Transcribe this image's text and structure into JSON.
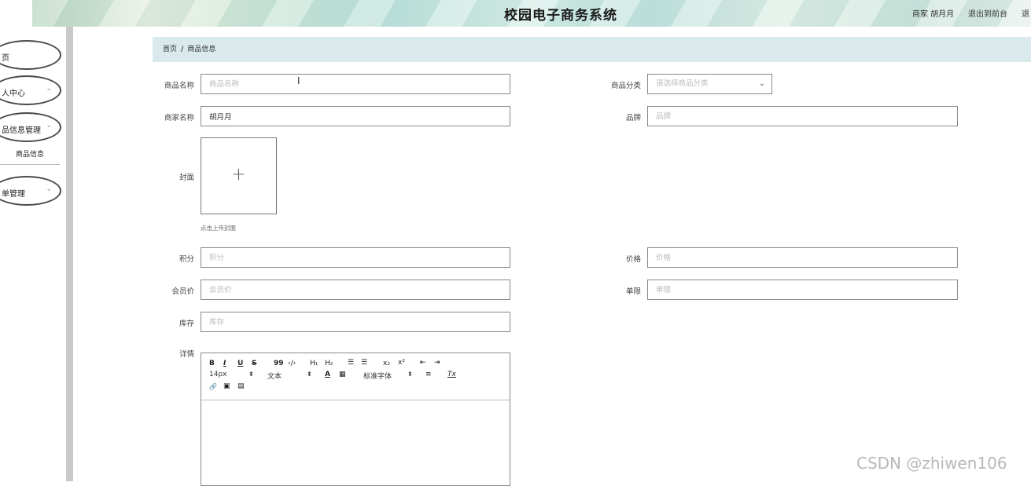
{
  "header": {
    "title": "校园电子商务系统",
    "user_label": "商家 胡月月",
    "front_link": "退出到前台",
    "logout_link": "退"
  },
  "sidebar": {
    "items": [
      {
        "label": "页",
        "has_chevron": false
      },
      {
        "label": "人中心",
        "has_chevron": true
      },
      {
        "label": "品信息管理",
        "has_chevron": true
      },
      {
        "label": "单管理",
        "has_chevron": true
      }
    ],
    "sub_item": "商品信息",
    "chevron": "⌄"
  },
  "breadcrumb": {
    "home": "首页",
    "separator": "/",
    "current": "商品信息"
  },
  "form": {
    "product_name": {
      "label": "商品名称",
      "value": "",
      "placeholder": "商品名称"
    },
    "category": {
      "label": "商品分类",
      "value": "",
      "placeholder": "请选择商品分类"
    },
    "merchant_name": {
      "label": "商家名称",
      "value": "胡月月",
      "placeholder": ""
    },
    "brand": {
      "label": "品牌",
      "value": "",
      "placeholder": "品牌"
    },
    "cover": {
      "label": "封面",
      "plus": "+",
      "hint": "点击上传封面"
    },
    "points": {
      "label": "积分",
      "value": "",
      "placeholder": "积分"
    },
    "price": {
      "label": "价格",
      "value": "",
      "placeholder": "价格"
    },
    "member_price": {
      "label": "会员价",
      "value": "",
      "placeholder": "会员价"
    },
    "limit": {
      "label": "单限",
      "value": "",
      "placeholder": "单限"
    },
    "stock": {
      "label": "库存",
      "value": "",
      "placeholder": "库存"
    },
    "details": {
      "label": "详情"
    }
  },
  "editor": {
    "font_size": "14px",
    "text_style": "文本",
    "font_family": "标准字体",
    "buttons": {
      "bold": "B",
      "italic": "I",
      "underline": "U",
      "strike": "S",
      "quote": "99",
      "code": "‹/›",
      "h1": "H₁",
      "h2": "H₂",
      "ordered_list": "☰",
      "bullet_list": "☰",
      "subscript": "x₂",
      "superscript": "x²",
      "indent_dec": "⇤",
      "indent_inc": "⇥",
      "color": "A",
      "background": "▦",
      "align": "≡",
      "clear": "Tx",
      "link": "🔗",
      "image": "▣",
      "video": "▤"
    }
  },
  "watermark": "CSDN @zhiwen106",
  "colors": {
    "breadcrumb_bg": "#d9e9ec",
    "sidebar_bar": "#c9c9c9"
  }
}
